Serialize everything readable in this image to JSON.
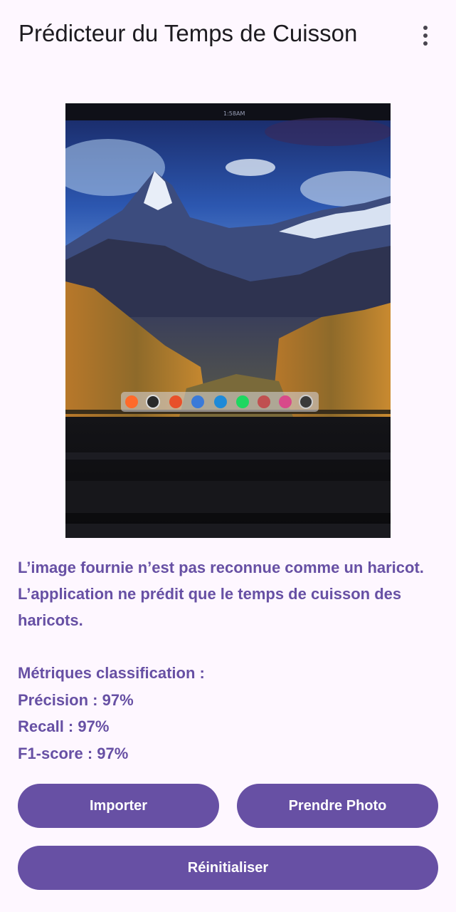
{
  "app_bar": {
    "title": "Prédicteur du Temps de Cuisson",
    "menu_icon": "more-vert-icon"
  },
  "photo": {
    "status_text": "1:58AM",
    "dock_icons": [
      "firefox-icon",
      "obs-icon",
      "brave-icon",
      "android-studio-icon",
      "vscode-icon",
      "spotify-icon",
      "folder-icon",
      "zotero-icon",
      "settings-icon"
    ]
  },
  "result": {
    "message": "L’image fournie n’est pas reconnue comme un haricot. L’application ne prédit que le temps de cuisson des haricots.",
    "metrics_title": "Métriques classification :",
    "precision": "Précision : 97%",
    "recall": "Recall : 97%",
    "f1": "F1-score : 97%"
  },
  "buttons": {
    "import_label": "Importer",
    "photo_label": "Prendre Photo",
    "reset_label": "Réinitialiser"
  },
  "colors": {
    "background": "#FEF7FF",
    "primary": "#6750A4",
    "on_primary": "#FFFFFF",
    "title_text": "#1D1B20"
  }
}
